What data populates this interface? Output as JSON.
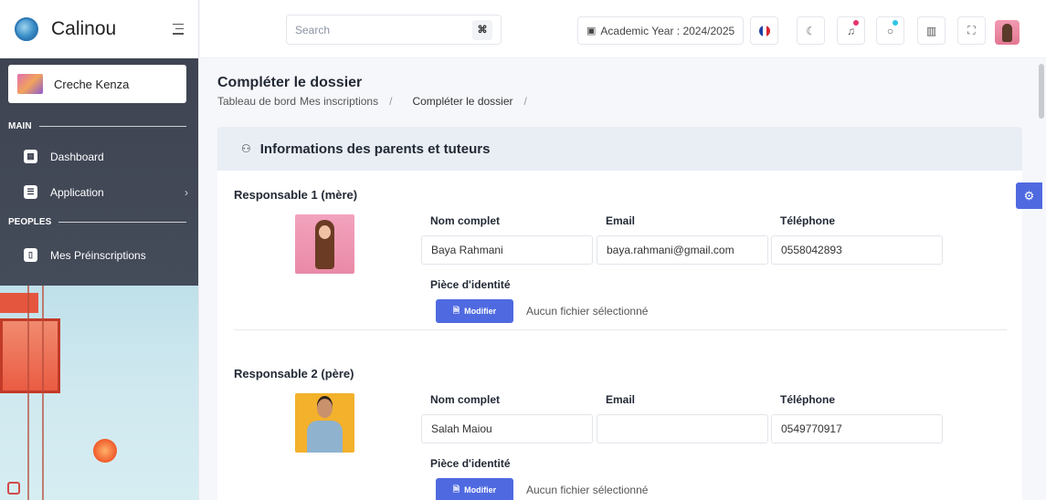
{
  "app": {
    "name": "Calinou"
  },
  "sidebar": {
    "school": "Creche Kenza",
    "sections": [
      {
        "label": "MAIN"
      },
      {
        "label": "PEOPLES"
      }
    ],
    "items": [
      {
        "label": "Dashboard",
        "icon": "grid-icon"
      },
      {
        "label": "Application",
        "icon": "layers-icon"
      },
      {
        "label": "Mes Préinscriptions",
        "icon": "file-icon"
      }
    ]
  },
  "topbar": {
    "search_placeholder": "Search",
    "search_shortcut": "⌘",
    "academic_year": "Academic Year : 2024/2025",
    "icons": [
      "flag-fr-icon",
      "moon-icon",
      "bell-icon",
      "chat-icon",
      "chart-icon",
      "fullscreen-icon"
    ],
    "notif_color": "#e6336a",
    "chat_color": "#2ec4e6"
  },
  "page": {
    "title": "Compléter le dossier",
    "breadcrumb": [
      "Tableau de bord",
      "Mes inscriptions",
      "Compléter le dossier"
    ]
  },
  "card": {
    "title": "Informations des parents et tuteurs"
  },
  "labels": {
    "full_name": "Nom complet",
    "email": "Email",
    "phone": "Téléphone",
    "id_doc": "Pièce d'identité",
    "modify": "Modifier",
    "no_file": "Aucun fichier sélectionné"
  },
  "responsables": [
    {
      "title": "Responsable 1 (mère)",
      "name": "Baya Rahmani",
      "email": "baya.rahmani@gmail.com",
      "phone": "0558042893"
    },
    {
      "title": "Responsable 2 (père)",
      "name": "Salah Maiou",
      "email": "",
      "phone": "0549770917"
    }
  ],
  "colors": {
    "accent": "#4f6ae0",
    "sidebar": "#434a58"
  }
}
